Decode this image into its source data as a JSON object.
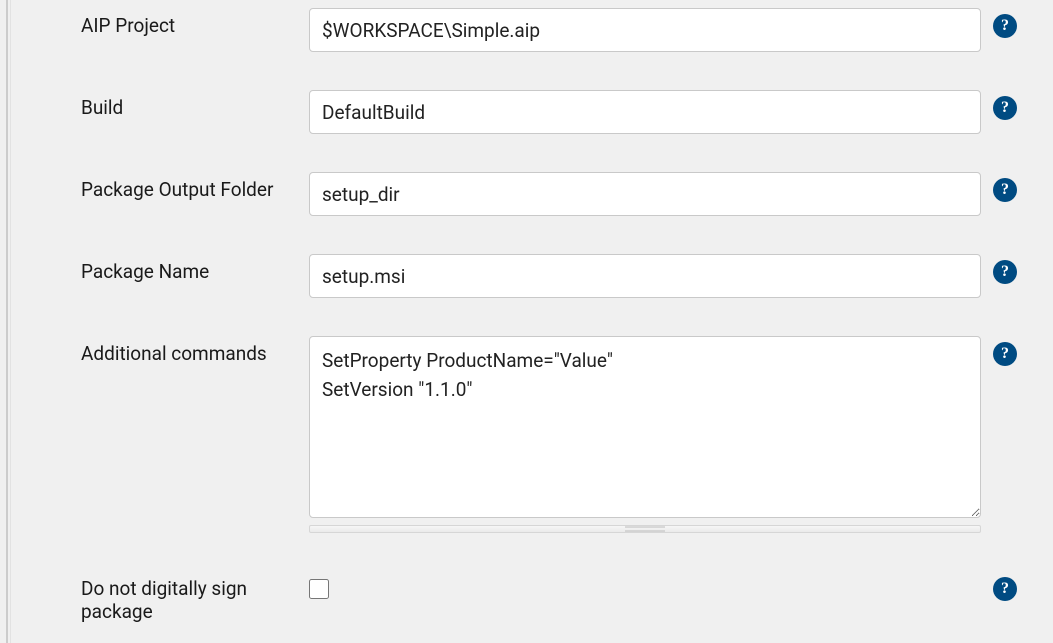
{
  "fields": {
    "aip_project": {
      "label": "AIP Project",
      "value": "$WORKSPACE\\Simple.aip"
    },
    "build": {
      "label": "Build",
      "value": "DefaultBuild"
    },
    "package_output_folder": {
      "label": "Package Output Folder",
      "value": "setup_dir"
    },
    "package_name": {
      "label": "Package Name",
      "value": "setup.msi"
    },
    "additional_commands": {
      "label": "Additional commands",
      "value": "SetProperty ProductName=\"Value\"\nSetVersion \"1.1.0\""
    },
    "do_not_sign": {
      "label": "Do not digitally sign package",
      "checked": false
    }
  },
  "help_glyph": "?"
}
